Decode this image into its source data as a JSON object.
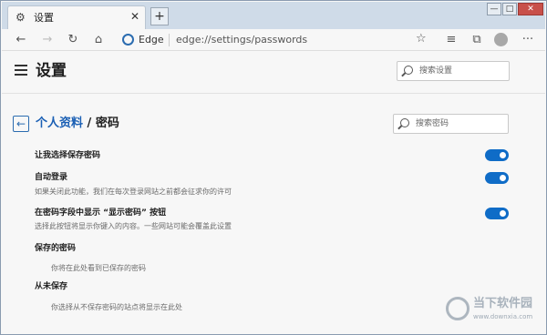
{
  "tab": {
    "icon": "gear-icon",
    "title": "设置",
    "close": "✕",
    "new_tab": "+"
  },
  "window_controls": {
    "minimize": "—",
    "maximize": "□",
    "close": "✕"
  },
  "toolbar": {
    "back_icon": "←",
    "forward_icon": "→",
    "refresh_icon": "↻",
    "home_icon": "⌂",
    "brand": "Edge",
    "url": "edge://settings/passwords",
    "favorite_icon": "☆",
    "collections_icon": "≡",
    "extensions_icon": "⧉",
    "menu_icon": "···"
  },
  "settings": {
    "title": "设置",
    "search_placeholder": "搜索设置"
  },
  "page": {
    "back_icon": "←",
    "breadcrumb_parent": "个人资料",
    "breadcrumb_sep": " / ",
    "breadcrumb_current": "密码",
    "search_placeholder": "搜索密码",
    "rows": [
      {
        "title": "让我选择保存密码",
        "description": "",
        "enabled": true
      },
      {
        "title": "自动登录",
        "description": "如果关闭此功能，我们在每次登录网站之前都会征求你的许可",
        "enabled": true
      },
      {
        "title": "在密码字段中显示 “显示密码” 按钮",
        "description": "选择此按钮将显示你键入的内容。一些网站可能会覆盖此设置",
        "enabled": true
      }
    ],
    "saved": {
      "title": "保存的密码",
      "empty": "你将在此处看到已保存的密码"
    },
    "never": {
      "title": "从未保存",
      "empty": "你选择从不保存密码的站点将显示在此处"
    }
  },
  "watermark": {
    "name": "当下软件园",
    "url": "www.downxia.com"
  },
  "colors": {
    "accent": "#0f6cc7",
    "link": "#1a5fb4"
  }
}
